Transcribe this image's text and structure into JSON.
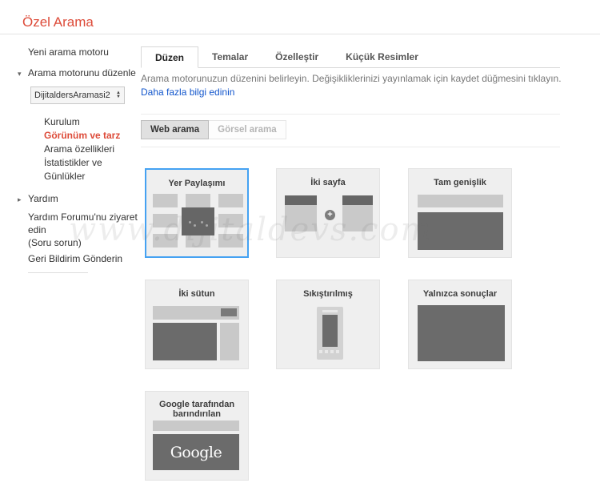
{
  "header": {
    "title": "Özel Arama"
  },
  "colors": {
    "accent_red": "#dd4b39",
    "link_blue": "#1155cc",
    "selected_border_blue": "#45a2f2",
    "dark_block": "#6b6b6b",
    "light_block": "#c9c9c9"
  },
  "sidebar": {
    "new_engine": "Yeni arama motoru",
    "edit_engine": "Arama motorunu düzenle",
    "engine_value": "DijitaldersAramasi2",
    "menu": [
      "Kurulum",
      "Görünüm ve tarz",
      "Arama özellikleri",
      "İstatistikler ve Günlükler"
    ],
    "help": "Yardım",
    "forum": "Yardım Forumu'nu ziyaret edin",
    "forum_note": "(Soru sorun)",
    "feedback": "Geri Bildirim Gönderin"
  },
  "tabs": {
    "layout": "Düzen",
    "themes": "Temalar",
    "customize": "Özelleştir",
    "thumbnails": "Küçük Resimler"
  },
  "main": {
    "description": "Arama motorunuzun düzenini belirleyin. Değişikliklerinizi yayınlamak için kaydet düğmesini tıklayın.",
    "learn_more": "Daha fazla bilgi edinin",
    "web_search": "Web arama",
    "image_search": "Görsel arama"
  },
  "layouts": {
    "overlay": "Yer Paylaşımı",
    "two_page": "İki sayfa",
    "full_width": "Tam genişlik",
    "two_column": "İki sütun",
    "compact": "Sıkıştırılmış",
    "results_only": "Yalnızca sonuçlar",
    "google_hosted": "Google tarafından barındırılan",
    "google_logo": "Google"
  },
  "watermark": "www.dijitaldevs.com"
}
